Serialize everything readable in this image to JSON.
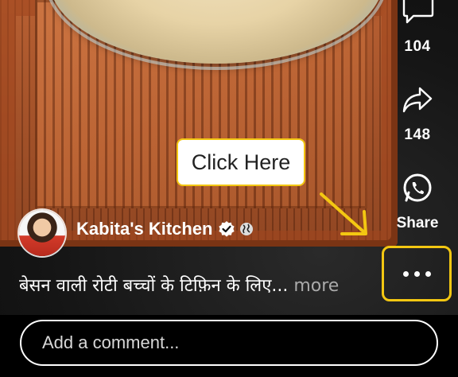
{
  "rail": {
    "comment_count": "104",
    "share_count": "148",
    "whatsapp_label": "Share"
  },
  "tooltip": {
    "text": "Click Here"
  },
  "channel": {
    "name": "Kabita's Kitchen"
  },
  "caption": {
    "text": "बेसन वाली रोटी बच्चों के टिफ़िन के लिए...",
    "more_label": " more"
  },
  "comment": {
    "placeholder": "Add a comment..."
  },
  "colors": {
    "highlight": "#f3c712",
    "text": "#ffffff",
    "whatsapp": "#ffffff"
  },
  "icons": {
    "comment": "comment-icon",
    "share": "share-icon",
    "whatsapp": "whatsapp-icon",
    "verified": "verified-icon",
    "globe": "globe-icon",
    "more": "more-options-icon",
    "arrow": "arrow-icon"
  }
}
